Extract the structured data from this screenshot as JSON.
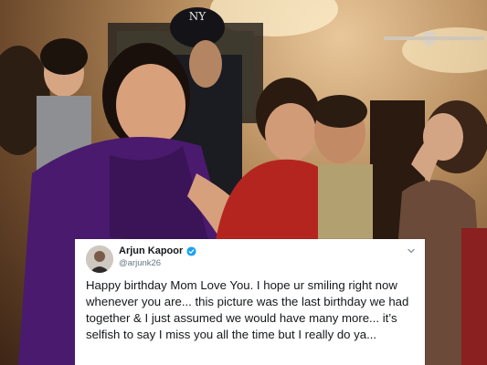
{
  "tweet": {
    "name": "Arjun Kapoor",
    "handle": "@arjunk26",
    "text": "Happy birthday Mom Love You. I hope ur smiling right now whenever you are... this picture was the last birthday we had together & I just assumed we would have many more... it’s selfish to say I miss you all the time but I really do ya...",
    "verified_color": "#1da1f2"
  },
  "photo": {
    "cap_logo": "NY"
  },
  "icons": [
    "verified-icon",
    "chevron-down-icon"
  ]
}
